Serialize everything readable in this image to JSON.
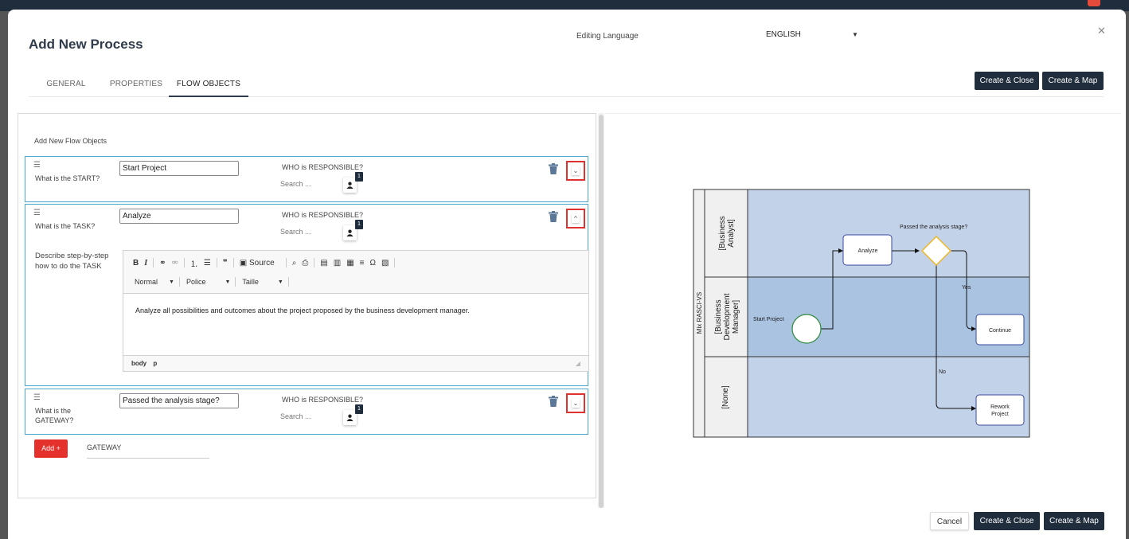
{
  "window": {
    "title": "Add New Process",
    "editing_language_label": "Editing Language",
    "language_value": "ENGLISH"
  },
  "tabs": [
    {
      "label": "GENERAL"
    },
    {
      "label": "PROPERTIES"
    },
    {
      "label": "FLOW OBJECTS",
      "active": true
    }
  ],
  "header_buttons": {
    "create_close": "Create & Close",
    "create_map": "Create & Map"
  },
  "flow_objects": {
    "heading": "Add New Flow Objects",
    "items": [
      {
        "label": "What is the START?",
        "name": "Start Project",
        "responsible_label": "WHO is RESPONSIBLE?",
        "search_placeholder": "Search ...",
        "responsible_count": "1",
        "toggle": "⌄"
      },
      {
        "label": "What is the TASK?",
        "name": "Analyze",
        "responsible_label": "WHO is RESPONSIBLE?",
        "search_placeholder": "Search ...",
        "responsible_count": "1",
        "toggle": "^",
        "description_label": "Describe step-by-step how to do the TASK",
        "editor": {
          "format": "Normal",
          "font": "Police",
          "size": "Taille",
          "source_label": "Source",
          "body_text": "Analyze all possibilities and outcomes about the project proposed by the business development manager.",
          "path_body": "body",
          "path_p": "p"
        }
      },
      {
        "label": "What is the GATEWAY?",
        "name": "Passed the analysis stage?",
        "responsible_label": "WHO is RESPONSIBLE?",
        "search_placeholder": "Search ...",
        "responsible_count": "1",
        "toggle": "⌄"
      }
    ],
    "add_button": "Add +",
    "add_type": "GATEWAY"
  },
  "diagram": {
    "pool_label": "Mix RASCI-VS",
    "lanes": [
      "[Business Analyst]",
      "[Business Development Manager]",
      "[None]"
    ],
    "lane_lines": {
      "business_analyst": [
        "[Business",
        "Analyst]"
      ],
      "business_development_manager": [
        "[Business",
        "Development",
        "Manager]"
      ],
      "none": [
        "[None]"
      ]
    },
    "nodes": {
      "start": "Start Project",
      "task": "Analyze",
      "gateway": "Passed the analysis stage?",
      "continue": "Continue",
      "rework_line1": "Rework",
      "rework_line2": "Project"
    },
    "edges": {
      "yes": "Yes",
      "no": "No"
    },
    "colors": {
      "lane_fill": "#c2d2e8",
      "lane_fill_mid": "#a9c3e1",
      "gateway_stroke": "#f2b21a",
      "start_stroke": "#2e8b3a",
      "task_stroke": "#3a4aa0"
    }
  },
  "footer_buttons": {
    "cancel": "Cancel",
    "create_close": "Create & Close",
    "create_map": "Create & Map"
  },
  "colors": {
    "dark_button": "#1f2d3d",
    "add_button": "#e5312b",
    "card_border": "#48a9cc",
    "toggle_highlight": "#e03131"
  },
  "icons": [
    "drag-handle-icon",
    "trash-icon",
    "user-icon",
    "chevron-down-icon",
    "chevron-up-icon",
    "close-icon",
    "caret-down-icon"
  ]
}
